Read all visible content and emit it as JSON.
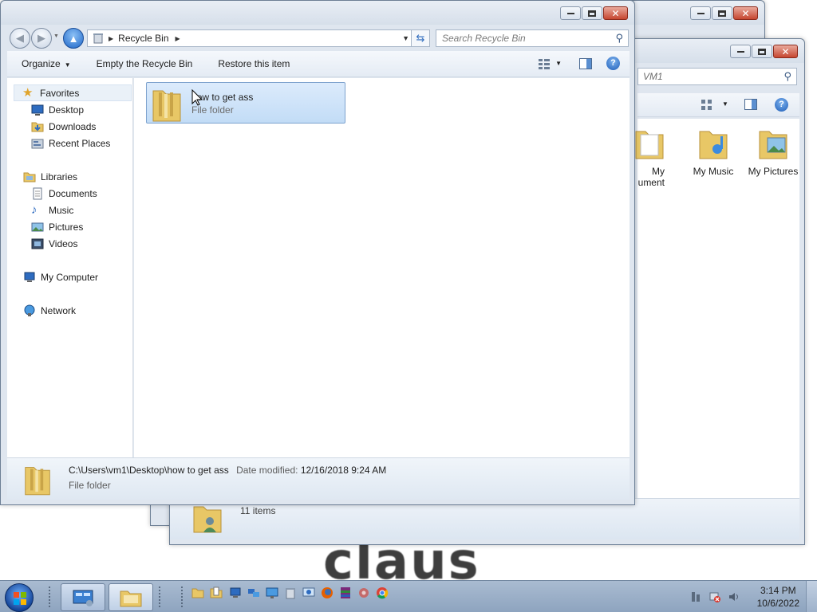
{
  "wallpaper": {
    "text": "claus"
  },
  "back_window": {
    "search_placeholder_partial": "VM1",
    "folders": [
      {
        "label": "My\nDocuments",
        "label_partial": "My",
        "label_partial2": "uments"
      },
      {
        "label": "My Music"
      },
      {
        "label": "My Pictures"
      }
    ],
    "status_count": "11 items"
  },
  "main_window": {
    "breadcrumb": "Recycle Bin",
    "search_placeholder": "Search Recycle Bin",
    "commands": {
      "organize": "Organize",
      "empty": "Empty the Recycle Bin",
      "restore": "Restore this item"
    },
    "nav": {
      "favorites": "Favorites",
      "desktop": "Desktop",
      "downloads": "Downloads",
      "recent": "Recent Places",
      "libraries": "Libraries",
      "documents": "Documents",
      "music": "Music",
      "pictures": "Pictures",
      "videos": "Videos",
      "computer": "My Computer",
      "network": "Network"
    },
    "item": {
      "name": "how to get ass",
      "type": "File folder"
    },
    "details": {
      "path": "C:\\Users\\vm1\\Desktop\\how to get ass",
      "date_label": "Date modified:",
      "date_value": "12/16/2018 9:24 AM",
      "type": "File folder"
    }
  },
  "taskbar": {
    "time": "3:14 PM",
    "date": "10/6/2022"
  },
  "colors": {
    "accent": "#1d65c8",
    "selection": "#c2dcf6",
    "close": "#c64630"
  }
}
